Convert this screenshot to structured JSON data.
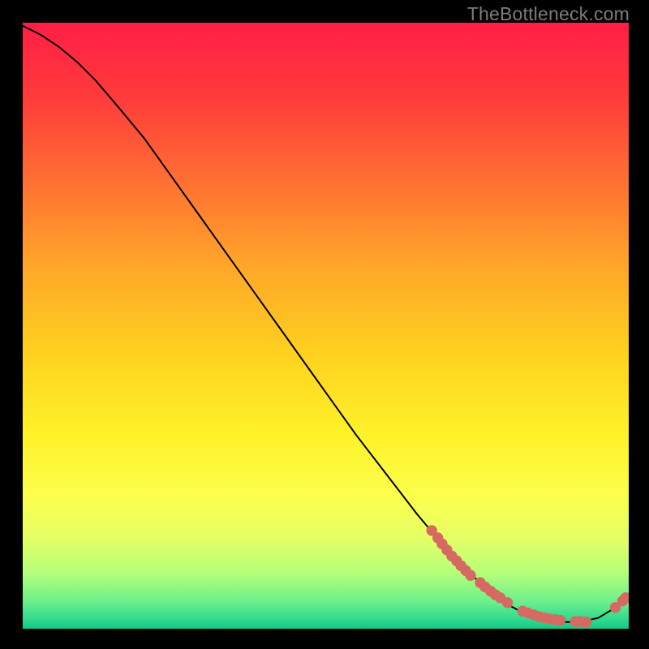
{
  "watermark": "TheBottleneck.com",
  "chart_data": {
    "type": "line",
    "title": "",
    "xlabel": "",
    "ylabel": "",
    "xlim": [
      0,
      100
    ],
    "ylim": [
      0,
      100
    ],
    "grid": false,
    "series": [
      {
        "name": "curve",
        "style": "line",
        "color": "#000000",
        "x": [
          0,
          3,
          6,
          9,
          12,
          15,
          20,
          25,
          30,
          35,
          40,
          45,
          50,
          55,
          60,
          65,
          70,
          75,
          80,
          83,
          86,
          89,
          92,
          95,
          98,
          100
        ],
        "y": [
          99.5,
          98.0,
          96.0,
          93.5,
          90.5,
          87.0,
          81.0,
          74.0,
          67.0,
          60.0,
          53.0,
          46.0,
          39.0,
          32.0,
          25.5,
          19.0,
          13.0,
          8.0,
          4.0,
          2.4,
          1.5,
          1.1,
          1.1,
          1.8,
          3.6,
          5.2
        ]
      },
      {
        "name": "dots",
        "style": "scatter",
        "color": "#d66a63",
        "x": [
          67.5,
          68.5,
          69.2,
          70.0,
          70.8,
          71.6,
          72.3,
          73.1,
          73.9,
          75.5,
          76.3,
          77.2,
          78.0,
          78.8,
          80.0,
          82.5,
          83.4,
          84.3,
          85.2,
          86.1,
          87.0,
          87.9,
          88.7,
          91.2,
          92.0,
          93.0,
          97.8,
          99.0,
          99.5
        ],
        "y": [
          16.2,
          15.0,
          14.0,
          13.0,
          12.0,
          11.2,
          10.4,
          9.6,
          8.8,
          7.6,
          6.9,
          6.2,
          5.6,
          5.1,
          4.3,
          2.9,
          2.6,
          2.3,
          2.0,
          1.8,
          1.6,
          1.5,
          1.4,
          1.2,
          1.2,
          1.1,
          3.5,
          4.6,
          5.1
        ]
      }
    ],
    "background_gradient": {
      "type": "vertical",
      "stops": [
        {
          "pos": 0.0,
          "color": "#ff1f46"
        },
        {
          "pos": 0.12,
          "color": "#ff3a3b"
        },
        {
          "pos": 0.26,
          "color": "#ff6f33"
        },
        {
          "pos": 0.4,
          "color": "#ffa629"
        },
        {
          "pos": 0.55,
          "color": "#ffd21f"
        },
        {
          "pos": 0.68,
          "color": "#fff229"
        },
        {
          "pos": 0.78,
          "color": "#fcff4c"
        },
        {
          "pos": 0.85,
          "color": "#e5ff66"
        },
        {
          "pos": 0.91,
          "color": "#b3ff7a"
        },
        {
          "pos": 0.955,
          "color": "#6cf08c"
        },
        {
          "pos": 0.985,
          "color": "#2fd98f"
        },
        {
          "pos": 1.0,
          "color": "#14c786"
        }
      ]
    }
  }
}
